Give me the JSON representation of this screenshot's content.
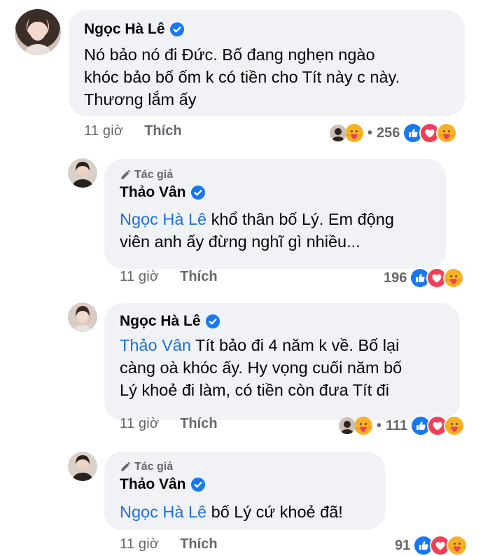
{
  "comments": [
    {
      "author": "Ngọc Hà Lê",
      "is_author_tag": false,
      "mention": "",
      "text_lines": [
        "Nó bảo nó đi Đức. Bố đang nghẹn ngào",
        "khóc bảo bố ốm k có tiền cho Tít này c này.",
        "Thương lắm ấy"
      ],
      "time": "11 giờ",
      "like_label": "Thích",
      "reaction_count": "256",
      "has_reply_avatars": true
    },
    {
      "author": "Thảo Vân",
      "author_tag": "Tác giả",
      "mention": "Ngọc Hà Lê",
      "text_lines": [
        " khổ thân bố Lý. Em động",
        "viên anh ấy đừng nghĩ gì nhiều..."
      ],
      "time": "11 giờ",
      "like_label": "Thích",
      "reaction_count": "196",
      "has_reply_avatars": false
    },
    {
      "author": "Ngọc Hà Lê",
      "mention": "Thảo Vân",
      "text_lines": [
        " Tít bảo đi 4 năm k về. Bố lại",
        "càng oà khóc ấy. Hy vọng cuối năm bố",
        "Lý khoẻ đi làm, có tiền còn đưa Tít đi"
      ],
      "time": "11 giờ",
      "like_label": "Thích",
      "reaction_count": "111",
      "has_reply_avatars": true
    },
    {
      "author": "Thảo Vân",
      "author_tag": "Tác giả",
      "mention": "Ngọc Hà Lê",
      "text_lines": [
        " bố Lý cứ khoẻ đã!"
      ],
      "time": "11 giờ",
      "like_label": "Thích",
      "reaction_count": "91",
      "has_reply_avatars": false
    }
  ],
  "icons": {
    "verified": "verified-badge-icon",
    "author_tag": "pencil-icon",
    "like_reaction": "like-reaction-icon",
    "love_reaction": "love-reaction-icon",
    "care_reaction": "care-reaction-icon",
    "dot": "•"
  },
  "colors": {
    "bubble": "#f0f2f5",
    "mention": "#216fdb",
    "verified": "#1877f2",
    "meta": "#65676b",
    "love": "#f33e58",
    "care": "#f7b125"
  }
}
